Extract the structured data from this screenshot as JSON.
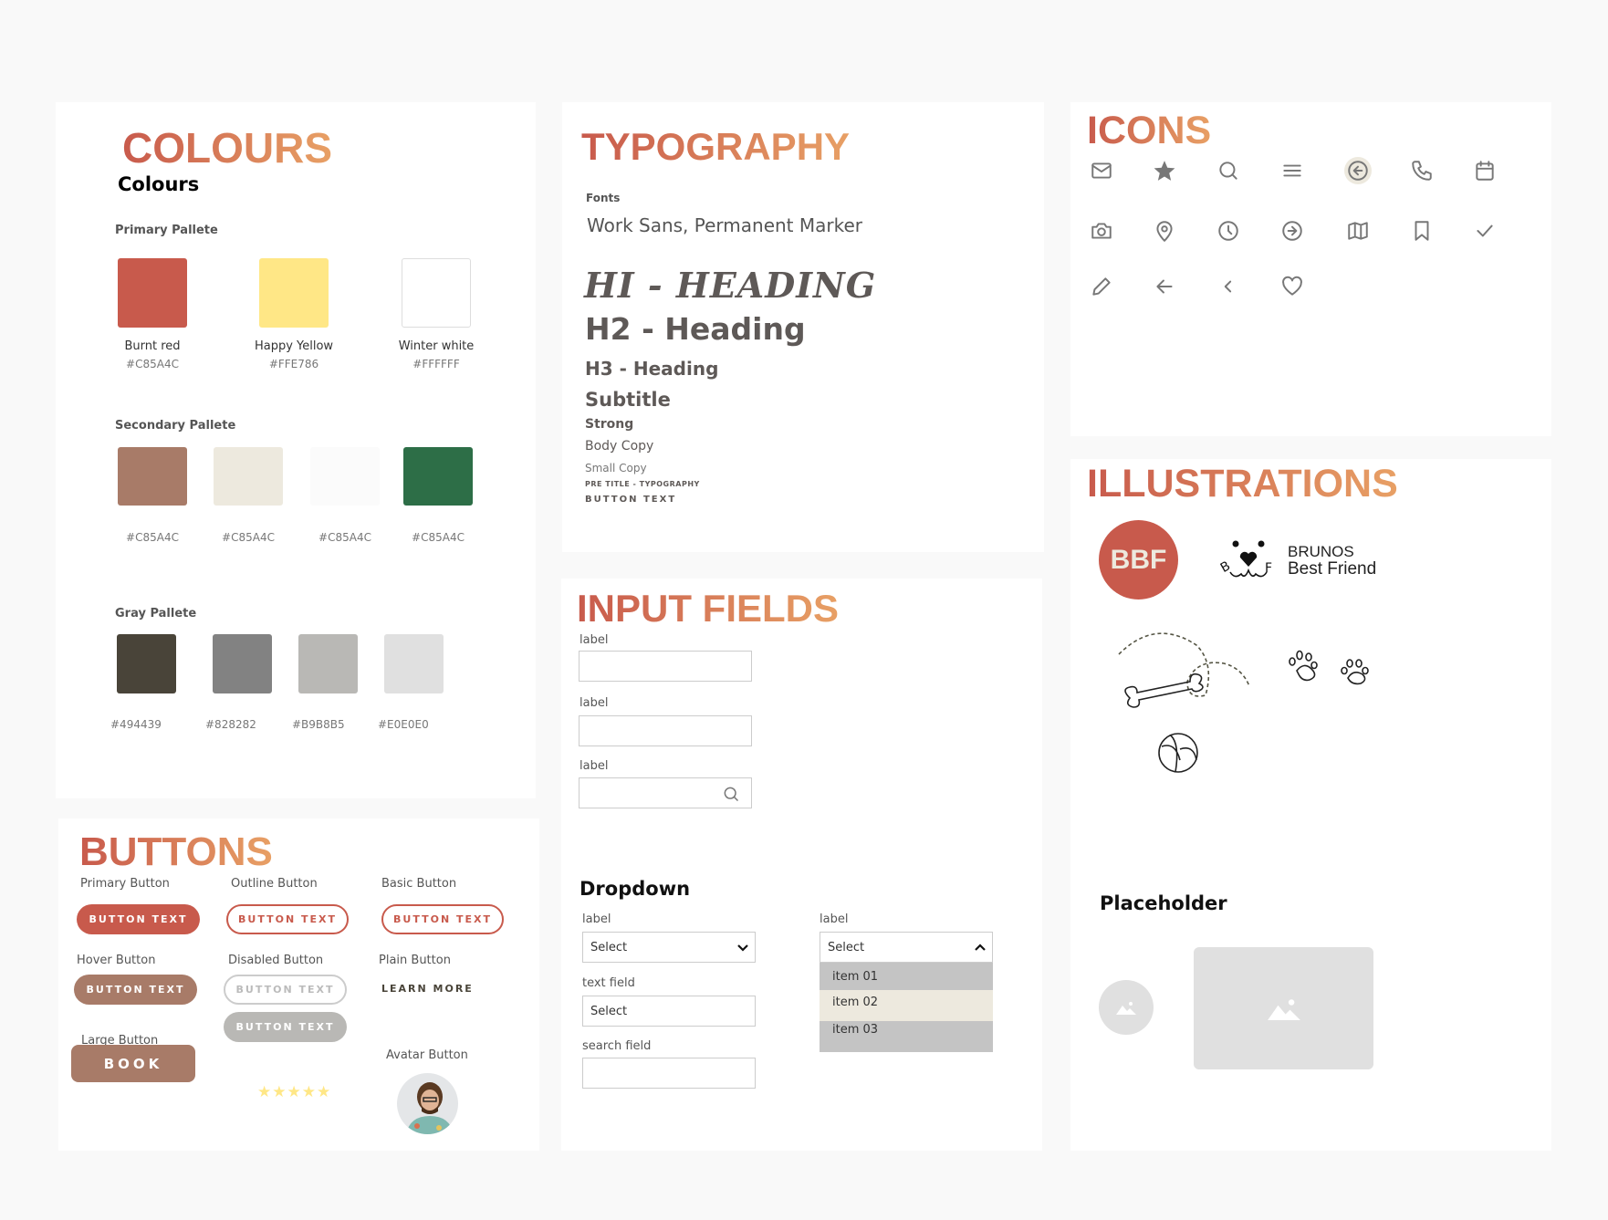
{
  "colours": {
    "title": "COLOURS",
    "subtitle": "Colours",
    "primary": {
      "label": "Primary Pallete",
      "swatches": [
        {
          "name": "Burnt red",
          "hex": "#C85A4C",
          "color": "#C85A4C"
        },
        {
          "name": "Happy Yellow",
          "hex": "#FFE786",
          "color": "#FFE786"
        },
        {
          "name": "Winter white",
          "hex": "#FFFFFF",
          "color": "#FFFFFF"
        }
      ]
    },
    "secondary": {
      "label": "Secondary Pallete",
      "swatches": [
        {
          "hex": "#C85A4C",
          "color": "#A87B68"
        },
        {
          "hex": "#C85A4C",
          "color": "#EDE9DE"
        },
        {
          "hex": "#C85A4C",
          "color": "#FBFBFB"
        },
        {
          "hex": "#C85A4C",
          "color": "#2D6E47"
        }
      ]
    },
    "gray": {
      "label": "Gray Pallete",
      "swatches": [
        {
          "hex": "#494439",
          "color": "#494439"
        },
        {
          "hex": "#828282",
          "color": "#828282"
        },
        {
          "hex": "#B9B8B5",
          "color": "#B9B8B5"
        },
        {
          "hex": "#E0E0E0",
          "color": "#E0E0E0"
        }
      ]
    }
  },
  "buttons": {
    "title": "BUTTONS",
    "primary": {
      "label": "Primary Button",
      "text": "BUTTON TEXT"
    },
    "outline": {
      "label": "Outline Button",
      "text": "BUTTON TEXT"
    },
    "basic": {
      "label": "Basic Button",
      "text": "BUTTON TEXT"
    },
    "hover": {
      "label": "Hover Button",
      "text": "BUTTON TEXT"
    },
    "disabled": {
      "label": "Disabled Button",
      "text": "BUTTON TEXT",
      "text2": "BUTTON TEXT"
    },
    "plain": {
      "label": "Plain Button",
      "text": "LEARN MORE"
    },
    "large": {
      "label": "Large Button",
      "text": "BOOK"
    },
    "rating": {
      "stars": 5,
      "value": 5
    },
    "avatar": {
      "label": "Avatar Button"
    }
  },
  "typography": {
    "title": "TYPOGRAPHY",
    "fonts_label": "Fonts",
    "fonts": "Work Sans, Permanent Marker",
    "h1": "HI - HEADING",
    "h2": "H2 - Heading",
    "h3": "H3 - Heading",
    "subtitle": "Subtitle",
    "strong": "Strong",
    "body": "Body Copy",
    "small": "Small Copy",
    "pretitle": "PRE TITLE - TYPOGRAPHY",
    "button": "BUTTON TEXT"
  },
  "inputs": {
    "title": "INPUT FIELDS",
    "fields": [
      {
        "label": "label",
        "value": ""
      },
      {
        "label": "label",
        "value": ""
      },
      {
        "label": "label",
        "value": ""
      }
    ],
    "dropdown": {
      "title": "Dropdown",
      "select1": {
        "label": "label",
        "value": "Select"
      },
      "text_field": {
        "label": "text field",
        "value": "Select"
      },
      "search_field": {
        "label": "search field",
        "value": ""
      },
      "select2": {
        "label": "label",
        "value": "Select",
        "items": [
          "item 01",
          "item 02",
          "item 03"
        ],
        "highlighted": "item 02"
      }
    }
  },
  "icons": {
    "title": "ICONS",
    "items": [
      "mail",
      "star",
      "search",
      "menu",
      "arrow-left-circle",
      "phone",
      "calendar",
      "camera",
      "map-pin",
      "clock",
      "arrow-right-circle",
      "map",
      "bookmark",
      "check",
      "pencil",
      "arrow-left",
      "chevron-left",
      "heart"
    ]
  },
  "illustrations": {
    "title": "ILLUSTRATIONS",
    "badge": "BBF",
    "logo": {
      "line1": "BRUNOS",
      "line2": "Best Friend"
    },
    "placeholder_title": "Placeholder"
  },
  "colors": {
    "accent": "#C85A4C",
    "hover": "#A87B68",
    "disabled": "#B9B8B5",
    "text": "#5E5957"
  }
}
